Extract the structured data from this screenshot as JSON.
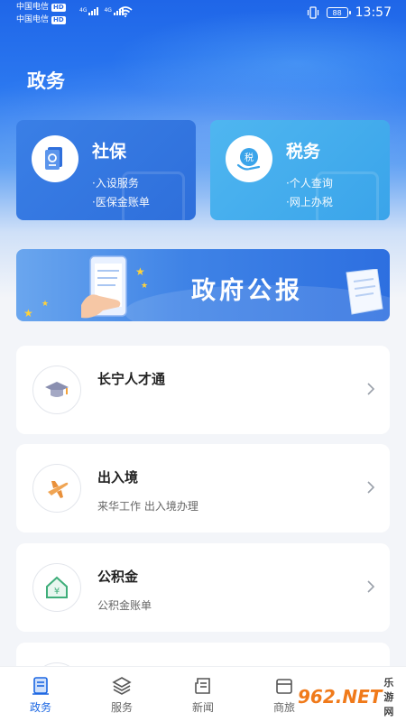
{
  "status_bar": {
    "carrier1": "中国电信",
    "carrier2": "中国电信",
    "hd": "HD",
    "net_label": "4G",
    "battery": "88",
    "time": "13:57"
  },
  "page_title": "政务",
  "cards": [
    {
      "title": "社保",
      "items": [
        "·入设服务",
        "·医保金账单"
      ],
      "icon": "social-security-icon"
    },
    {
      "title": "税务",
      "items": [
        "·个人查询",
        "·网上办税"
      ],
      "icon": "tax-icon"
    }
  ],
  "banner": {
    "title": "政府公报"
  },
  "list": [
    {
      "title": "长宁人才通",
      "subtitle": "",
      "icon": "graduation-cap-icon"
    },
    {
      "title": "出入境",
      "subtitle": "来华工作 出入境办理",
      "icon": "airplane-icon"
    },
    {
      "title": "公积金",
      "subtitle": "公积金账单",
      "icon": "house-fund-icon"
    },
    {
      "title": "",
      "subtitle": "",
      "icon": "partial-icon"
    }
  ],
  "bottom_nav": [
    {
      "label": "政务",
      "active": true,
      "icon": "government-icon"
    },
    {
      "label": "服务",
      "active": false,
      "icon": "layers-icon"
    },
    {
      "label": "新闻",
      "active": false,
      "icon": "news-icon"
    },
    {
      "label": "商旅",
      "active": false,
      "icon": "travel-icon"
    }
  ],
  "watermark": {
    "text": "962.NET",
    "sub": "乐游网"
  },
  "colors": {
    "primary": "#1c67e2",
    "social_card": "#2e6fdb",
    "tax_card": "#3aa4ea",
    "accent_orange": "#f07a1a"
  }
}
